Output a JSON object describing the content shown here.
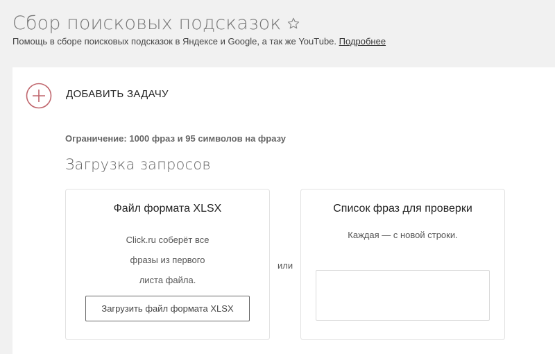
{
  "header": {
    "title": "Сбор поисковых подсказок",
    "subtitle": "Помощь в сборе поисковых подсказок в Яндексе и Google, а так же YouTube.",
    "more_link": "Подробнее",
    "favorite_icon": "star-outline-icon"
  },
  "add_task": {
    "label": "ДОБАВИТЬ ЗАДАЧУ",
    "icon": "plus-circle-icon",
    "accent_color": "#c0666d"
  },
  "limit_note": "Ограничение: 1000 фраз и 95 символов на фразу",
  "upload_section": {
    "title": "Загрузка запросов",
    "xlsx_panel": {
      "title": "Файл формата XLSX",
      "description_lines": [
        "Click.ru соберёт все",
        "фразы из первого",
        "листа файла."
      ],
      "button_label": "Загрузить файл формата XLSX"
    },
    "separator": "или",
    "list_panel": {
      "title": "Список фраз для проверки",
      "hint": "Каждая — с новой строки.",
      "textarea_value": ""
    }
  }
}
